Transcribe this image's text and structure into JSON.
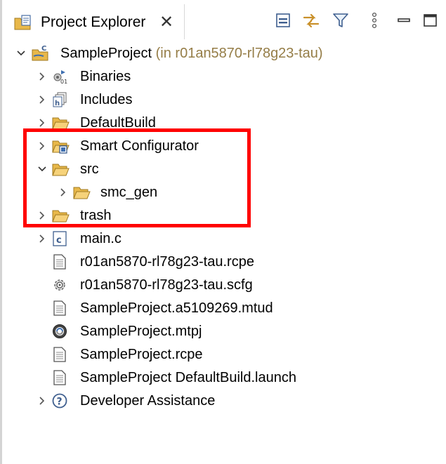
{
  "tab": {
    "title": "Project Explorer",
    "close": "✕"
  },
  "toolbar": [
    {
      "name": "collapse-all-icon"
    },
    {
      "name": "link-with-editor-icon"
    },
    {
      "name": "filter-icon"
    },
    {
      "name": "view-menu-icon"
    },
    {
      "name": "minimize-icon"
    },
    {
      "name": "maximize-icon"
    }
  ],
  "tree": {
    "project": {
      "label": "SampleProject",
      "decoration": "(in r01an5870-rl78g23-tau)"
    },
    "items": [
      {
        "label": "Binaries"
      },
      {
        "label": "Includes"
      },
      {
        "label": "DefaultBuild"
      },
      {
        "label": "Smart Configurator"
      },
      {
        "label": "src"
      },
      {
        "label": "smc_gen"
      },
      {
        "label": "trash"
      },
      {
        "label": "main.c"
      },
      {
        "label": "r01an5870-rl78g23-tau.rcpe"
      },
      {
        "label": "r01an5870-rl78g23-tau.scfg"
      },
      {
        "label": "SampleProject.a5109269.mtud"
      },
      {
        "label": "SampleProject.mtpj"
      },
      {
        "label": "SampleProject.rcpe"
      },
      {
        "label": "SampleProject DefaultBuild.launch"
      },
      {
        "label": "Developer Assistance"
      }
    ]
  },
  "colors": {
    "highlight": "#ff0000",
    "folder": "#e8b84a",
    "decoration": "#957d47"
  }
}
